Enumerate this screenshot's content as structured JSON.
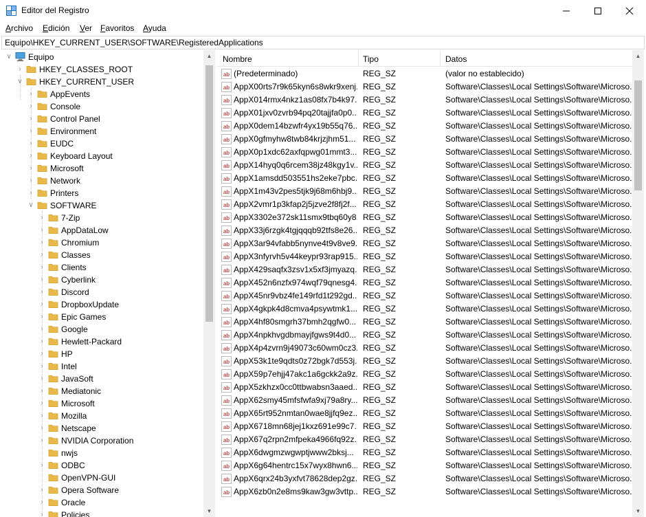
{
  "window": {
    "title": "Editor del Registro",
    "icon": "regedit-icon"
  },
  "menu": [
    {
      "label_first": "A",
      "label_rest": "rchivo"
    },
    {
      "label_first": "E",
      "label_rest": "dición"
    },
    {
      "label_first": "V",
      "label_rest": "er"
    },
    {
      "label_first": "F",
      "label_rest": "avoritos"
    },
    {
      "label_first": "A",
      "label_rest": "yuda"
    }
  ],
  "address": "Equipo\\HKEY_CURRENT_USER\\SOFTWARE\\RegisteredApplications",
  "tree": {
    "root": "Equipo",
    "hives": [
      "HKEY_CLASSES_ROOT",
      "HKEY_CURRENT_USER"
    ],
    "hkcu_children": [
      "AppEvents",
      "Console",
      "Control Panel",
      "Environment",
      "EUDC",
      "Keyboard Layout",
      "Microsoft",
      "Network",
      "Printers",
      "SOFTWARE"
    ],
    "software_children": [
      "7-Zip",
      "AppDataLow",
      "Chromium",
      "Classes",
      "Clients",
      "Cyberlink",
      "Discord",
      "DropboxUpdate",
      "Epic Games",
      "Google",
      "Hewlett-Packard",
      "HP",
      "Intel",
      "JavaSoft",
      "Mediatonic",
      "Microsoft",
      "Mozilla",
      "Netscape",
      "NVIDIA Corporation",
      "nwjs",
      "ODBC",
      "OpenVPN-GUI",
      "Opera Software",
      "Oracle",
      "Policies"
    ]
  },
  "list": {
    "headers": {
      "name": "Nombre",
      "type": "Tipo",
      "data": "Datos"
    },
    "rows": [
      {
        "name": "(Predeterminado)",
        "type": "REG_SZ",
        "data": "(valor no establecido)"
      },
      {
        "name": "AppX00rts7r9k65kyn6s8wkr9xenj...",
        "type": "REG_SZ",
        "data": "Software\\Classes\\Local Settings\\Software\\Microso..."
      },
      {
        "name": "AppX014rmx4nkz1as08fx7b4k97...",
        "type": "REG_SZ",
        "data": "Software\\Classes\\Local Settings\\Software\\Microso..."
      },
      {
        "name": "AppX01jxv0zvrb94pq20tajjfa0p0...",
        "type": "REG_SZ",
        "data": "Software\\Classes\\Local Settings\\Software\\Microso..."
      },
      {
        "name": "AppX0dem14bzwfr4yx19b55q76...",
        "type": "REG_SZ",
        "data": "Software\\Classes\\Local Settings\\Software\\Microso..."
      },
      {
        "name": "AppX0gfmyhw8twb84krjzjhm51...",
        "type": "REG_SZ",
        "data": "Software\\Classes\\Local Settings\\Software\\Microso..."
      },
      {
        "name": "AppX0p1xdc62axfqpwg01mmt3...",
        "type": "REG_SZ",
        "data": "Software\\Classes\\Local Settings\\Software\\Microso..."
      },
      {
        "name": "AppX14hyq0q6rcem38jz48kgy1v...",
        "type": "REG_SZ",
        "data": "Software\\Classes\\Local Settings\\Software\\Microso..."
      },
      {
        "name": "AppX1amsdd503551hs2eke7pbc...",
        "type": "REG_SZ",
        "data": "Software\\Classes\\Local Settings\\Software\\Microso..."
      },
      {
        "name": "AppX1m43v2pes5tjk9j68m6hbj9...",
        "type": "REG_SZ",
        "data": "Software\\Classes\\Local Settings\\Software\\Microso..."
      },
      {
        "name": "AppX2vmr1p3kfap2j5jzve2f8fj2f...",
        "type": "REG_SZ",
        "data": "Software\\Classes\\Local Settings\\Software\\Microso..."
      },
      {
        "name": "AppX3302e372sk11smx9tbq60y8...",
        "type": "REG_SZ",
        "data": "Software\\Classes\\Local Settings\\Software\\Microso..."
      },
      {
        "name": "AppX33j6rzgk4tgjqqqb92tfs8e26...",
        "type": "REG_SZ",
        "data": "Software\\Classes\\Local Settings\\Software\\Microso..."
      },
      {
        "name": "AppX3ar94vfabb5nynve4t9v8ve9...",
        "type": "REG_SZ",
        "data": "Software\\Classes\\Local Settings\\Software\\Microso..."
      },
      {
        "name": "AppX3nfyrvh5v44keypr93rap915...",
        "type": "REG_SZ",
        "data": "Software\\Classes\\Local Settings\\Software\\Microso..."
      },
      {
        "name": "AppX429saqfx3zsv1x5xf3jmyazq...",
        "type": "REG_SZ",
        "data": "Software\\Classes\\Local Settings\\Software\\Microso..."
      },
      {
        "name": "AppX452n6nzfx974wqf79qnesg4...",
        "type": "REG_SZ",
        "data": "Software\\Classes\\Local Settings\\Software\\Microso..."
      },
      {
        "name": "AppX45nr9vbz4fe149rfd1t292gd...",
        "type": "REG_SZ",
        "data": "Software\\Classes\\Local Settings\\Software\\Microso..."
      },
      {
        "name": "AppX4gkpk4d8cmva4psywtmk1...",
        "type": "REG_SZ",
        "data": "Software\\Classes\\Local Settings\\Software\\Microso..."
      },
      {
        "name": "AppX4hf80smgrh37bmh2qgfw0...",
        "type": "REG_SZ",
        "data": "Software\\Classes\\Local Settings\\Software\\Microso..."
      },
      {
        "name": "AppX4npkhvgdbmayjfgws9t4d0...",
        "type": "REG_SZ",
        "data": "Software\\Classes\\Local Settings\\Software\\Microso..."
      },
      {
        "name": "AppX4p4zvrn9j49073c60wm0cz3...",
        "type": "REG_SZ",
        "data": "Software\\Classes\\Local Settings\\Software\\Microso..."
      },
      {
        "name": "AppX53k1te9qdts0z72bgk7d553j...",
        "type": "REG_SZ",
        "data": "Software\\Classes\\Local Settings\\Software\\Microso..."
      },
      {
        "name": "AppX59p7ehjj47akc1a6gckk2a9z...",
        "type": "REG_SZ",
        "data": "Software\\Classes\\Local Settings\\Software\\Microso..."
      },
      {
        "name": "AppX5zkhzx0cc0ttbwabsn3aaed...",
        "type": "REG_SZ",
        "data": "Software\\Classes\\Local Settings\\Software\\Microso..."
      },
      {
        "name": "AppX62smy45mfsfwfa9xj79a8ry...",
        "type": "REG_SZ",
        "data": "Software\\Classes\\Local Settings\\Software\\Microso..."
      },
      {
        "name": "AppX65rt952nmtan0wae8jjfq9ez...",
        "type": "REG_SZ",
        "data": "Software\\Classes\\Local Settings\\Software\\Microso..."
      },
      {
        "name": "AppX6718mn68jej1kxz691e99c7...",
        "type": "REG_SZ",
        "data": "Software\\Classes\\Local Settings\\Software\\Microso..."
      },
      {
        "name": "AppX67q2rpn2mfpeka4966fq92z...",
        "type": "REG_SZ",
        "data": "Software\\Classes\\Local Settings\\Software\\Microso..."
      },
      {
        "name": "AppX6dwgmzwgwptjwww2bksj...",
        "type": "REG_SZ",
        "data": "Software\\Classes\\Local Settings\\Software\\Microso..."
      },
      {
        "name": "AppX6g64hentrc15x7wyx8hwn6...",
        "type": "REG_SZ",
        "data": "Software\\Classes\\Local Settings\\Software\\Microso..."
      },
      {
        "name": "AppX6qrx24b3yxfvt78628dep2gz...",
        "type": "REG_SZ",
        "data": "Software\\Classes\\Local Settings\\Software\\Microso..."
      },
      {
        "name": "AppX6zb0n2e8ms9kaw3gw3vttp...",
        "type": "REG_SZ",
        "data": "Software\\Classes\\Local Settings\\Software\\Microso..."
      }
    ]
  },
  "colors": {
    "folder": "#e8b84a",
    "folder_dark": "#d9a631",
    "ab_icon": "#c0504d"
  }
}
